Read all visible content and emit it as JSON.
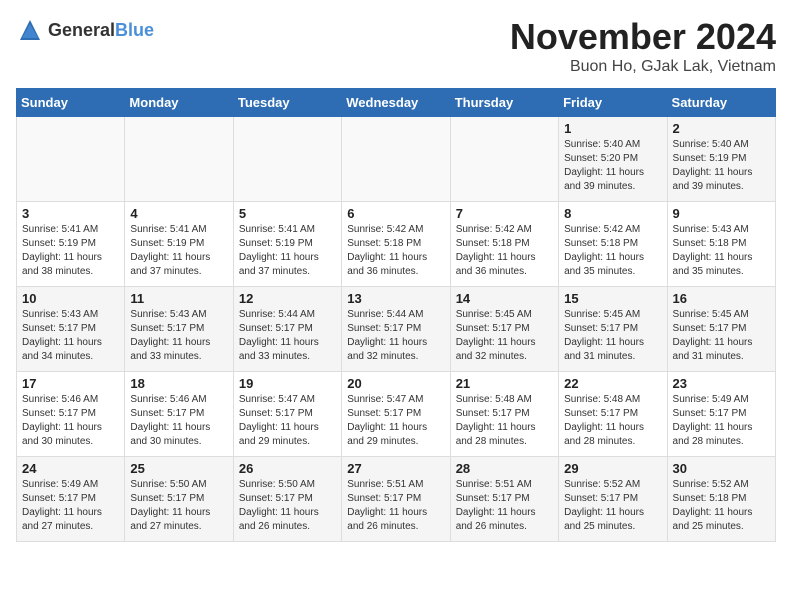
{
  "logo": {
    "text_general": "General",
    "text_blue": "Blue"
  },
  "header": {
    "month": "November 2024",
    "location": "Buon Ho, GJak Lak, Vietnam"
  },
  "weekdays": [
    "Sunday",
    "Monday",
    "Tuesday",
    "Wednesday",
    "Thursday",
    "Friday",
    "Saturday"
  ],
  "weeks": [
    {
      "days": [
        {
          "num": "",
          "info": ""
        },
        {
          "num": "",
          "info": ""
        },
        {
          "num": "",
          "info": ""
        },
        {
          "num": "",
          "info": ""
        },
        {
          "num": "",
          "info": ""
        },
        {
          "num": "1",
          "info": "Sunrise: 5:40 AM\nSunset: 5:20 PM\nDaylight: 11 hours and 39 minutes."
        },
        {
          "num": "2",
          "info": "Sunrise: 5:40 AM\nSunset: 5:19 PM\nDaylight: 11 hours and 39 minutes."
        }
      ]
    },
    {
      "days": [
        {
          "num": "3",
          "info": "Sunrise: 5:41 AM\nSunset: 5:19 PM\nDaylight: 11 hours and 38 minutes."
        },
        {
          "num": "4",
          "info": "Sunrise: 5:41 AM\nSunset: 5:19 PM\nDaylight: 11 hours and 37 minutes."
        },
        {
          "num": "5",
          "info": "Sunrise: 5:41 AM\nSunset: 5:19 PM\nDaylight: 11 hours and 37 minutes."
        },
        {
          "num": "6",
          "info": "Sunrise: 5:42 AM\nSunset: 5:18 PM\nDaylight: 11 hours and 36 minutes."
        },
        {
          "num": "7",
          "info": "Sunrise: 5:42 AM\nSunset: 5:18 PM\nDaylight: 11 hours and 36 minutes."
        },
        {
          "num": "8",
          "info": "Sunrise: 5:42 AM\nSunset: 5:18 PM\nDaylight: 11 hours and 35 minutes."
        },
        {
          "num": "9",
          "info": "Sunrise: 5:43 AM\nSunset: 5:18 PM\nDaylight: 11 hours and 35 minutes."
        }
      ]
    },
    {
      "days": [
        {
          "num": "10",
          "info": "Sunrise: 5:43 AM\nSunset: 5:17 PM\nDaylight: 11 hours and 34 minutes."
        },
        {
          "num": "11",
          "info": "Sunrise: 5:43 AM\nSunset: 5:17 PM\nDaylight: 11 hours and 33 minutes."
        },
        {
          "num": "12",
          "info": "Sunrise: 5:44 AM\nSunset: 5:17 PM\nDaylight: 11 hours and 33 minutes."
        },
        {
          "num": "13",
          "info": "Sunrise: 5:44 AM\nSunset: 5:17 PM\nDaylight: 11 hours and 32 minutes."
        },
        {
          "num": "14",
          "info": "Sunrise: 5:45 AM\nSunset: 5:17 PM\nDaylight: 11 hours and 32 minutes."
        },
        {
          "num": "15",
          "info": "Sunrise: 5:45 AM\nSunset: 5:17 PM\nDaylight: 11 hours and 31 minutes."
        },
        {
          "num": "16",
          "info": "Sunrise: 5:45 AM\nSunset: 5:17 PM\nDaylight: 11 hours and 31 minutes."
        }
      ]
    },
    {
      "days": [
        {
          "num": "17",
          "info": "Sunrise: 5:46 AM\nSunset: 5:17 PM\nDaylight: 11 hours and 30 minutes."
        },
        {
          "num": "18",
          "info": "Sunrise: 5:46 AM\nSunset: 5:17 PM\nDaylight: 11 hours and 30 minutes."
        },
        {
          "num": "19",
          "info": "Sunrise: 5:47 AM\nSunset: 5:17 PM\nDaylight: 11 hours and 29 minutes."
        },
        {
          "num": "20",
          "info": "Sunrise: 5:47 AM\nSunset: 5:17 PM\nDaylight: 11 hours and 29 minutes."
        },
        {
          "num": "21",
          "info": "Sunrise: 5:48 AM\nSunset: 5:17 PM\nDaylight: 11 hours and 28 minutes."
        },
        {
          "num": "22",
          "info": "Sunrise: 5:48 AM\nSunset: 5:17 PM\nDaylight: 11 hours and 28 minutes."
        },
        {
          "num": "23",
          "info": "Sunrise: 5:49 AM\nSunset: 5:17 PM\nDaylight: 11 hours and 28 minutes."
        }
      ]
    },
    {
      "days": [
        {
          "num": "24",
          "info": "Sunrise: 5:49 AM\nSunset: 5:17 PM\nDaylight: 11 hours and 27 minutes."
        },
        {
          "num": "25",
          "info": "Sunrise: 5:50 AM\nSunset: 5:17 PM\nDaylight: 11 hours and 27 minutes."
        },
        {
          "num": "26",
          "info": "Sunrise: 5:50 AM\nSunset: 5:17 PM\nDaylight: 11 hours and 26 minutes."
        },
        {
          "num": "27",
          "info": "Sunrise: 5:51 AM\nSunset: 5:17 PM\nDaylight: 11 hours and 26 minutes."
        },
        {
          "num": "28",
          "info": "Sunrise: 5:51 AM\nSunset: 5:17 PM\nDaylight: 11 hours and 26 minutes."
        },
        {
          "num": "29",
          "info": "Sunrise: 5:52 AM\nSunset: 5:17 PM\nDaylight: 11 hours and 25 minutes."
        },
        {
          "num": "30",
          "info": "Sunrise: 5:52 AM\nSunset: 5:18 PM\nDaylight: 11 hours and 25 minutes."
        }
      ]
    }
  ]
}
